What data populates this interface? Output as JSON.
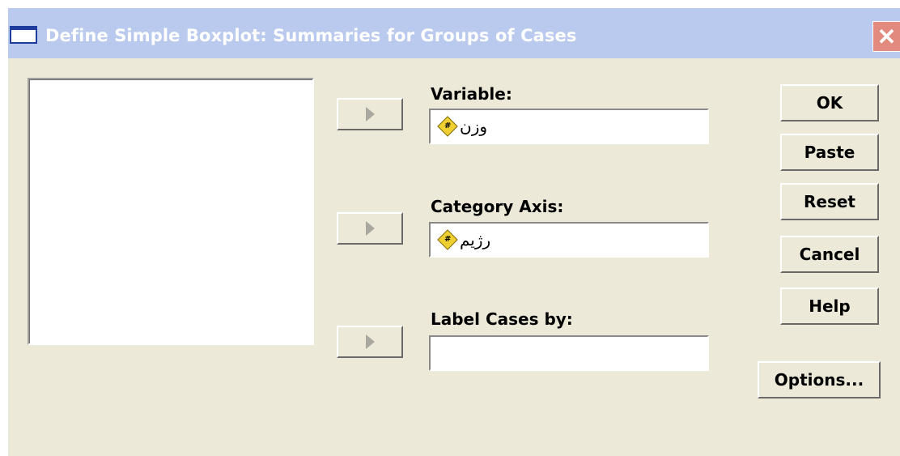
{
  "window": {
    "title": "Define Simple Boxplot: Summaries for Groups of Cases",
    "close_glyph": "✕"
  },
  "fields": {
    "variable": {
      "label": "Variable:",
      "value": "وزن",
      "icon": "scale-variable-icon"
    },
    "category_axis": {
      "label": "Category Axis:",
      "value": "رژیم",
      "icon": "scale-variable-icon"
    },
    "label_cases": {
      "label": "Label Cases by:",
      "value": ""
    }
  },
  "buttons": {
    "ok": "OK",
    "paste": "Paste",
    "reset": "Reset",
    "cancel": "Cancel",
    "help": "Help",
    "options": "Options..."
  },
  "icon_glyph": "#",
  "colors": {
    "dialog_bg": "#ece9d8",
    "titlebar": "#bac9ee",
    "close": "#e18a7d",
    "variable_icon": "#f0d030"
  }
}
